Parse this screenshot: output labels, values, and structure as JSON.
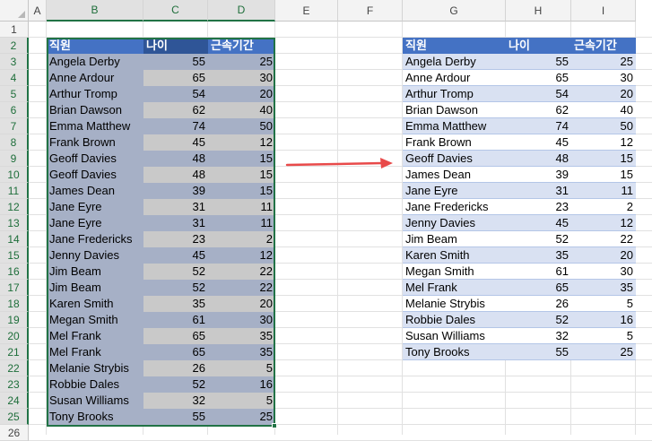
{
  "columns": [
    "A",
    "B",
    "C",
    "D",
    "E",
    "F",
    "G",
    "H",
    "I"
  ],
  "rows": [
    "1",
    "2",
    "3",
    "4",
    "5",
    "6",
    "7",
    "8",
    "9",
    "10",
    "11",
    "12",
    "13",
    "14",
    "15",
    "16",
    "17",
    "18",
    "19",
    "20",
    "21",
    "22",
    "23",
    "24",
    "25",
    "26"
  ],
  "left_table": {
    "headers": [
      "직원",
      "나이",
      "근속기간"
    ],
    "rows": [
      [
        "Angela Derby",
        "55",
        "25"
      ],
      [
        "Anne Ardour",
        "65",
        "30"
      ],
      [
        "Arthur Tromp",
        "54",
        "20"
      ],
      [
        "Brian Dawson",
        "62",
        "40"
      ],
      [
        "Emma Matthew",
        "74",
        "50"
      ],
      [
        "Frank Brown",
        "45",
        "12"
      ],
      [
        "Geoff Davies",
        "48",
        "15"
      ],
      [
        "Geoff Davies",
        "48",
        "15"
      ],
      [
        "James Dean",
        "39",
        "15"
      ],
      [
        "Jane Eyre",
        "31",
        "11"
      ],
      [
        "Jane Eyre",
        "31",
        "11"
      ],
      [
        "Jane Fredericks",
        "23",
        "2"
      ],
      [
        "Jenny Davies",
        "45",
        "12"
      ],
      [
        "Jim Beam",
        "52",
        "22"
      ],
      [
        "Jim Beam",
        "52",
        "22"
      ],
      [
        "Karen Smith",
        "35",
        "20"
      ],
      [
        "Megan Smith",
        "61",
        "30"
      ],
      [
        "Mel Frank",
        "65",
        "35"
      ],
      [
        "Mel Frank",
        "65",
        "35"
      ],
      [
        "Melanie Strybis",
        "26",
        "5"
      ],
      [
        "Robbie Dales",
        "52",
        "16"
      ],
      [
        "Susan Williams",
        "32",
        "5"
      ],
      [
        "Tony Brooks",
        "55",
        "25"
      ]
    ]
  },
  "right_table": {
    "headers": [
      "직원",
      "나이",
      "근속기간"
    ],
    "rows": [
      [
        "Angela Derby",
        "55",
        "25"
      ],
      [
        "Anne Ardour",
        "65",
        "30"
      ],
      [
        "Arthur Tromp",
        "54",
        "20"
      ],
      [
        "Brian Dawson",
        "62",
        "40"
      ],
      [
        "Emma Matthew",
        "74",
        "50"
      ],
      [
        "Frank Brown",
        "45",
        "12"
      ],
      [
        "Geoff Davies",
        "48",
        "15"
      ],
      [
        "James Dean",
        "39",
        "15"
      ],
      [
        "Jane Eyre",
        "31",
        "11"
      ],
      [
        "Jane Fredericks",
        "23",
        "2"
      ],
      [
        "Jenny Davies",
        "45",
        "12"
      ],
      [
        "Jim Beam",
        "52",
        "22"
      ],
      [
        "Karen Smith",
        "35",
        "20"
      ],
      [
        "Megan Smith",
        "61",
        "30"
      ],
      [
        "Mel Frank",
        "65",
        "35"
      ],
      [
        "Melanie Strybis",
        "26",
        "5"
      ],
      [
        "Robbie Dales",
        "52",
        "16"
      ],
      [
        "Susan Williams",
        "32",
        "5"
      ],
      [
        "Tony Brooks",
        "55",
        "25"
      ]
    ]
  },
  "colors": {
    "header_fill": "#4472c4",
    "left_header_dark": "#2f5597",
    "left_band_dark": "#a6b0c6",
    "left_band_light": "#c9c9c9",
    "right_band": "#d9e1f2",
    "selection": "#217346",
    "arrow": "#e84a4a"
  },
  "selected_columns": [
    "B",
    "C",
    "D"
  ]
}
